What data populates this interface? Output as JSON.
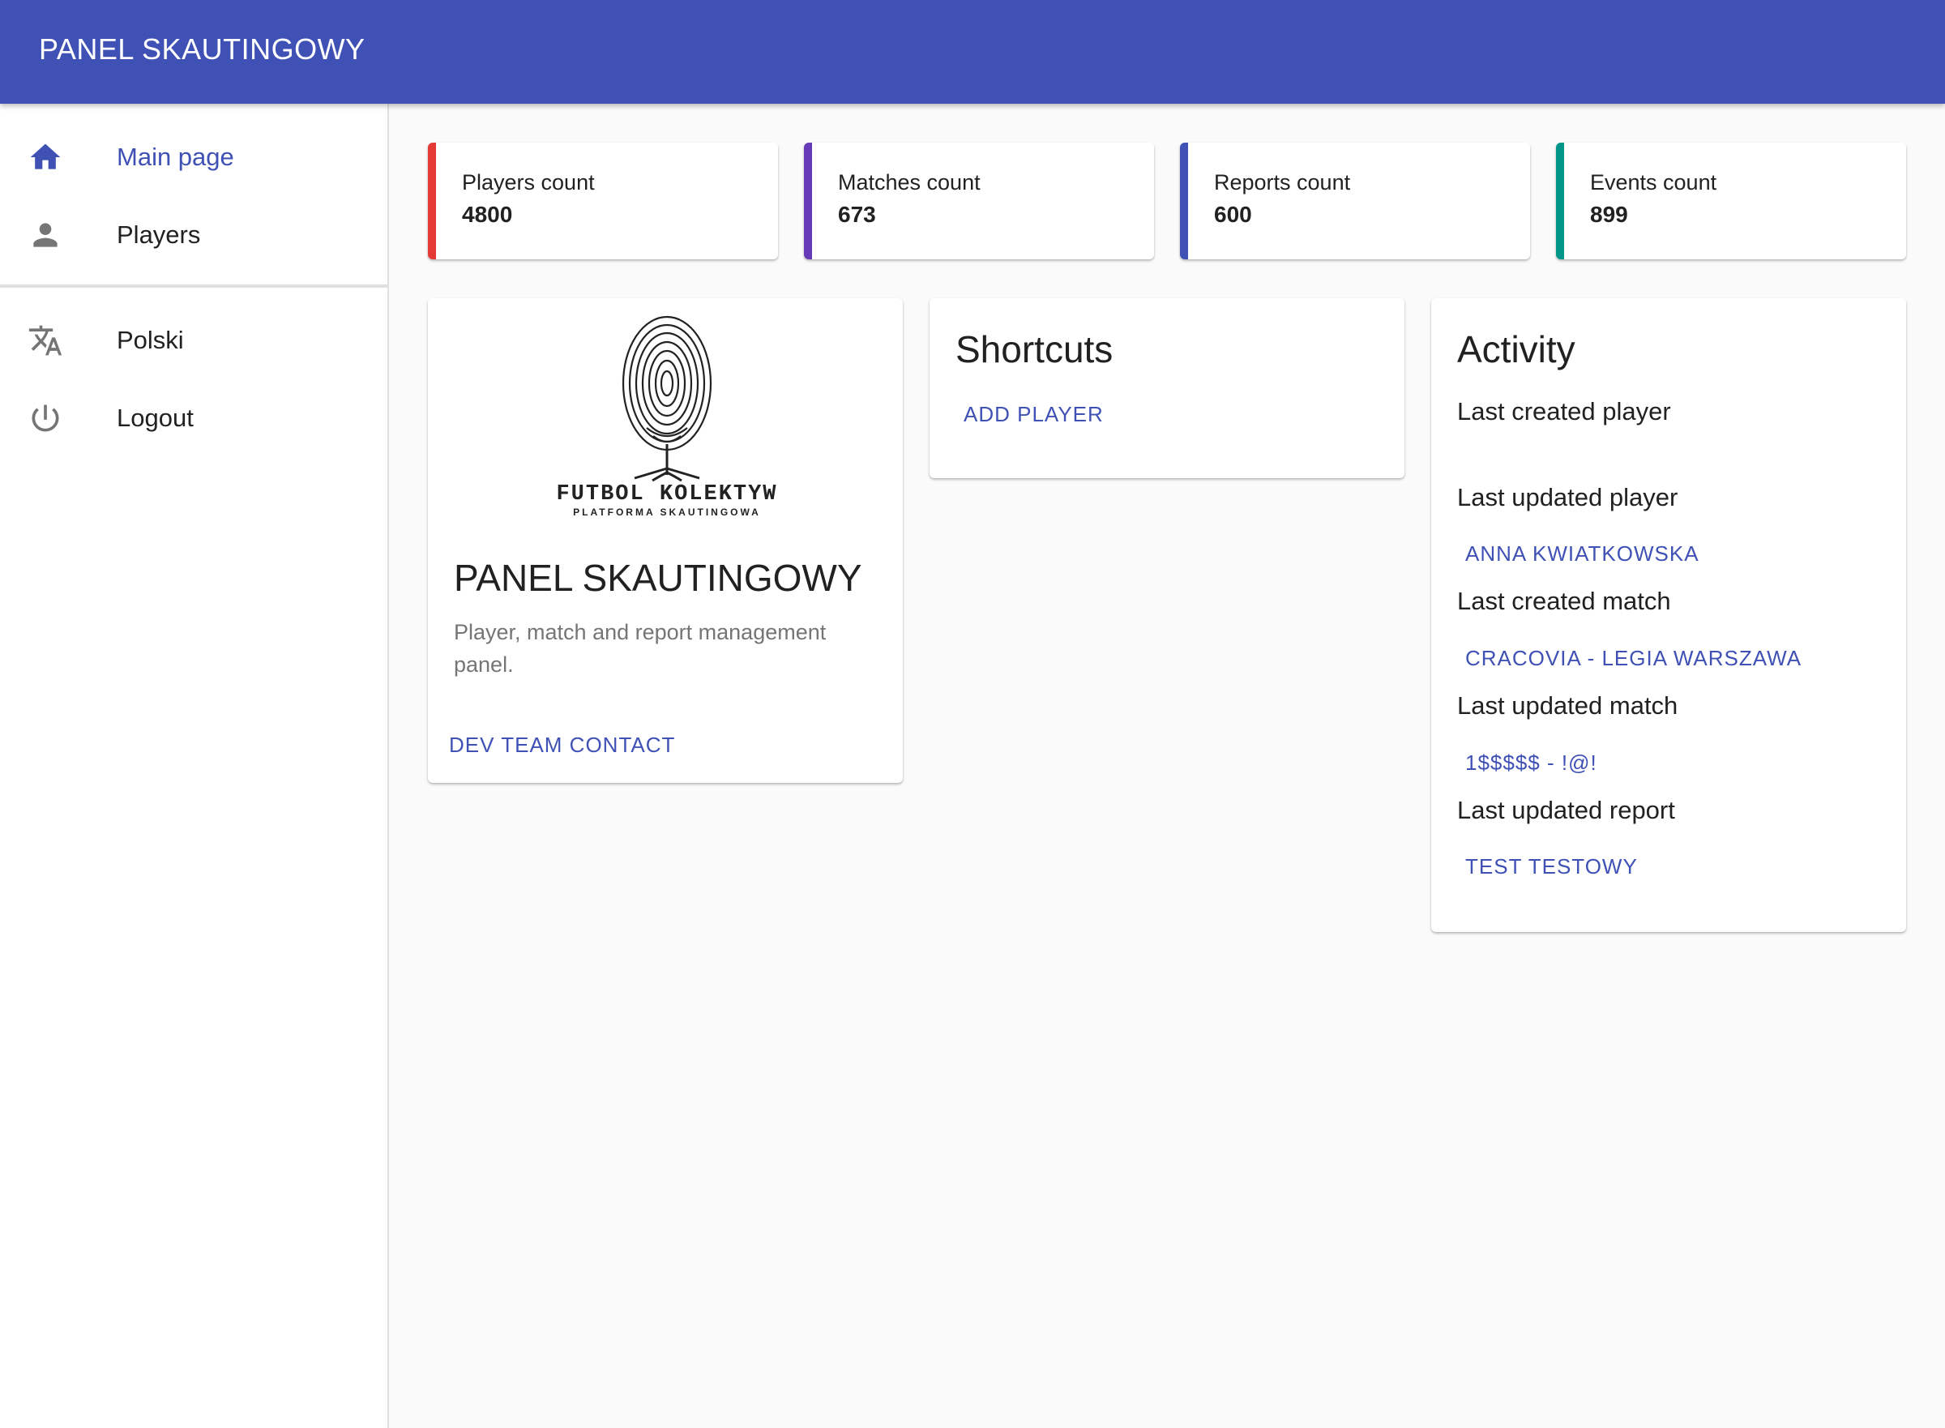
{
  "app": {
    "title": "PANEL SKAUTINGOWY"
  },
  "nav": {
    "main_page": "Main page",
    "players": "Players",
    "language": "Polski",
    "logout": "Logout"
  },
  "stats": [
    {
      "label": "Players count",
      "value": "4800",
      "color": "#e53935"
    },
    {
      "label": "Matches count",
      "value": "673",
      "color": "#673ab7"
    },
    {
      "label": "Reports count",
      "value": "600",
      "color": "#3f51b5"
    },
    {
      "label": "Events count",
      "value": "899",
      "color": "#009688"
    }
  ],
  "about": {
    "logo_line1": "FUTBOL KOLEKTYW",
    "logo_line2": "PLATFORMA SKAUTINGOWA",
    "title": "PANEL SKAUTINGOWY",
    "description": "Player, match and report management panel.",
    "contact_button": "DEV TEAM CONTACT"
  },
  "shortcuts": {
    "title": "Shortcuts",
    "add_player": "ADD PLAYER"
  },
  "activity": {
    "title": "Activity",
    "last_created_player_label": "Last created player",
    "last_updated_player_label": "Last updated player",
    "last_updated_player_value": "ANNA KWIATKOWSKA",
    "last_created_match_label": "Last created match",
    "last_created_match_value": "CRACOVIA - LEGIA WARSZAWA",
    "last_updated_match_label": "Last updated match",
    "last_updated_match_value": "1$$$$$ - !@!",
    "last_updated_report_label": "Last updated report",
    "last_updated_report_value": "TEST TESTOWY"
  },
  "colors": {
    "primary": "#3f51b5",
    "background": "#fafafa"
  }
}
